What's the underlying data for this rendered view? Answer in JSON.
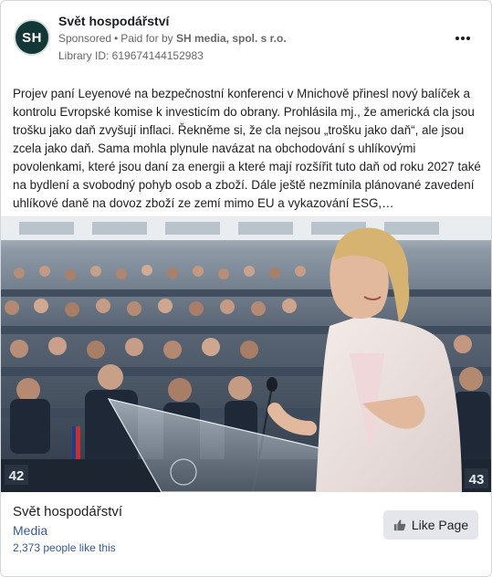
{
  "post": {
    "page_name": "Svět hospodářství",
    "avatar_initials": "SH",
    "sponsored_label": "Sponsored",
    "paid_for_prefix": "Paid for by",
    "payer": "SH media, spol. s r.o.",
    "library_id": "Library ID: 619674144152983",
    "more_icon": "more-horizontal-icon",
    "body_text": "Projev paní Leyenové na bezpečnostní konferenci v Mnichově přinesl nový balíček a kontrolu Evropské komise k investicím do obrany. Prohlásila mj., že americká cla jsou trošku jako daň zvyšují inflaci. Řekněme si, že cla nejsou „trošku jako daň“, ale jsou zcela jako daň. Sama mohla plynule navázat na obchodování s uhlíkovými povolenkami, které jsou daní za energii a které mají rozšířit tuto daň od roku 2027 také na bydlení a svobodný pohyb osob a zboží. Dále ještě nezmínila plánované zavedení uhlíkové daně na dovoz zboží ze zemí mimo EU a vykazování ESG,…"
  },
  "media": {
    "seat_numbers": [
      "42",
      "43"
    ]
  },
  "footer": {
    "page_name": "Svět hospodářství",
    "category": "Media",
    "likes": "2,373 people like this",
    "like_button_label": "Like Page",
    "like_icon": "thumbs-up-icon"
  },
  "colors": {
    "avatar_bg": "#133636",
    "link_blue": "#385898",
    "button_bg": "#e4e6eb",
    "secondary_text": "#65676b"
  }
}
